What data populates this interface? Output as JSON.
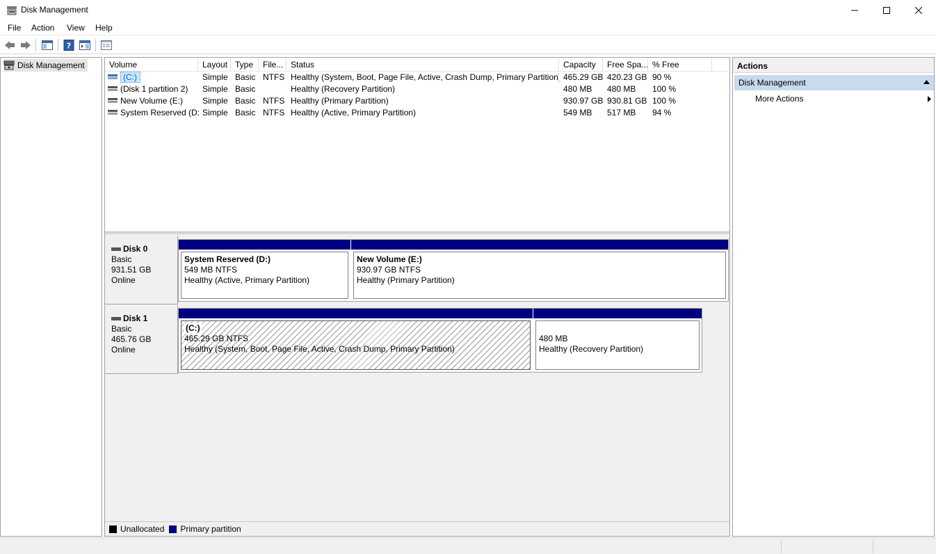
{
  "window": {
    "title": "Disk Management"
  },
  "menu": [
    "File",
    "Action",
    "View",
    "Help"
  ],
  "tree": {
    "root_label": "Disk Management"
  },
  "volume_list": {
    "columns": [
      "Volume",
      "Layout",
      "Type",
      "File...",
      "Status",
      "Capacity",
      "Free Spa...",
      "% Free"
    ],
    "rows": [
      {
        "volume": "(C:)",
        "layout": "Simple",
        "type": "Basic",
        "fs": "NTFS",
        "status": "Healthy (System, Boot, Page File, Active, Crash Dump, Primary Partition)",
        "capacity": "465.29 GB",
        "free": "420.23 GB",
        "pct": "90 %",
        "selected": true
      },
      {
        "volume": "(Disk 1 partition 2)",
        "layout": "Simple",
        "type": "Basic",
        "fs": "",
        "status": "Healthy (Recovery Partition)",
        "capacity": "480 MB",
        "free": "480 MB",
        "pct": "100 %",
        "selected": false
      },
      {
        "volume": "New Volume (E:)",
        "layout": "Simple",
        "type": "Basic",
        "fs": "NTFS",
        "status": "Healthy (Primary Partition)",
        "capacity": "930.97 GB",
        "free": "930.81 GB",
        "pct": "100 %",
        "selected": false
      },
      {
        "volume": "System Reserved (D:)",
        "layout": "Simple",
        "type": "Basic",
        "fs": "NTFS",
        "status": "Healthy (Active, Primary Partition)",
        "capacity": "549 MB",
        "free": "517 MB",
        "pct": "94 %",
        "selected": false
      }
    ]
  },
  "disks": [
    {
      "name": "Disk 0",
      "kind": "Basic",
      "size": "931.51 GB",
      "state": "Online",
      "partitions": [
        {
          "title": "System Reserved  (D:)",
          "detail": "549 MB NTFS",
          "status": "Healthy (Active, Primary Partition)"
        },
        {
          "title": "New Volume  (E:)",
          "detail": "930.97 GB NTFS",
          "status": "Healthy (Primary Partition)"
        }
      ]
    },
    {
      "name": "Disk 1",
      "kind": "Basic",
      "size": "465.76 GB",
      "state": "Online",
      "partitions": [
        {
          "title": "(C:)",
          "detail": "465.29 GB NTFS",
          "status": "Healthy (System, Boot, Page File, Active, Crash Dump, Primary Partition)"
        },
        {
          "title": "",
          "detail": "480 MB",
          "status": "Healthy (Recovery Partition)"
        }
      ]
    }
  ],
  "legend": [
    {
      "label": "Unallocated",
      "color": "#000000"
    },
    {
      "label": "Primary partition",
      "color": "#000080"
    }
  ],
  "actions": {
    "header": "Actions",
    "section": "Disk Management",
    "items": [
      "More Actions"
    ]
  },
  "colors": {
    "primary_partition": "#000080",
    "selection": "#cce8ff",
    "actions_section": "#c9d9ee"
  }
}
